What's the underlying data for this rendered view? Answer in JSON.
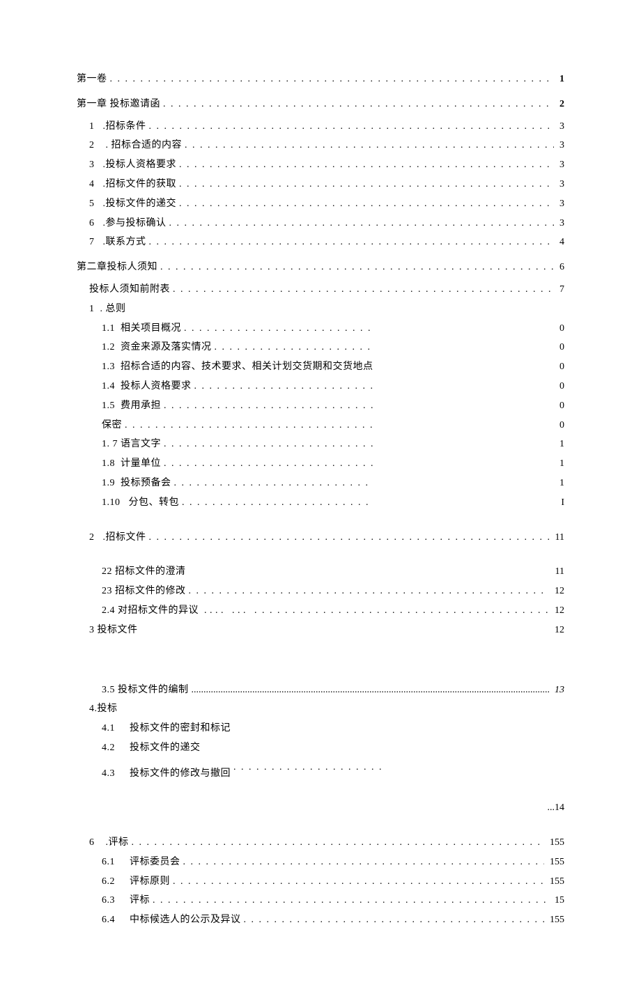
{
  "toc": {
    "vol1": {
      "label": "第一卷",
      "page": "1"
    },
    "ch1": {
      "label": "第一章   投标邀请函",
      "page": "2"
    },
    "ch1_items": [
      {
        "num": "1",
        "title": ".招标条件",
        "page": "3"
      },
      {
        "num": "2",
        "title": " . 招标合适的内容",
        "page": "3"
      },
      {
        "num": "3",
        "title": ".投标人资格要求",
        "page": "3"
      },
      {
        "num": "4",
        "title": ".招标文件的获取",
        "page": "3"
      },
      {
        "num": "5",
        "title": ".投标文件的递交",
        "page": "3"
      },
      {
        "num": "6",
        "title": ".参与投标确认",
        "page": "3"
      },
      {
        "num": "7",
        "title": ".联系方式",
        "page": "4"
      }
    ],
    "ch2": {
      "label": "第二章投标人须知",
      "page": "6"
    },
    "ch2_pre": {
      "label": "投标人须知前附表",
      "page": "7"
    },
    "s1": {
      "num": "1",
      "title": ". 总则",
      "page": ""
    },
    "s1_items_a": [
      {
        "num": "1.1",
        "title": "相关项目概况",
        "page": "0"
      },
      {
        "num": "1.2",
        "title": "资金来源及落实情况",
        "page": "0"
      },
      {
        "num": "1.3",
        "title": "招标合适的内容、技术要求、相关计划交货期和交货地点…",
        "page": "0"
      },
      {
        "num": "1.4",
        "title": "投标人资格要求",
        "page": "0"
      },
      {
        "num": "1.5",
        "title": "费用承担",
        "page": "0"
      },
      {
        "num": "",
        "title": "保密",
        "page": "0"
      },
      {
        "num": "",
        "title": "1. 7 语言文字",
        "page": "1"
      },
      {
        "num": "1.8",
        "title": "计量单位",
        "page": "1"
      },
      {
        "num": "1.9",
        "title": "投标预备会",
        "page": "1"
      },
      {
        "num": "1.10",
        "title": " 分包、转包",
        "page": "I"
      }
    ],
    "s2": {
      "num": "2",
      "title": ".招标文件",
      "page": "11"
    },
    "s2_items": [
      {
        "num": "",
        "title": "22 招标文件的澄清",
        "page": "11",
        "leader": "blank"
      },
      {
        "num": "",
        "title": "23 招标文件的修改",
        "page": "12",
        "leader": "dots"
      },
      {
        "num": "",
        "title": "2.4 对招标文件的异议",
        "page": "12",
        "leader": "dots",
        "extra_gap": true
      }
    ],
    "s3": {
      "label": "3 投标文件",
      "page": "12"
    },
    "s3_5": {
      "label": "3.5 投标文件的编制",
      "page": "13"
    },
    "s4": {
      "label": "4.投标",
      "page": ""
    },
    "s4_items": [
      {
        "num": "4.1",
        "title": "投标文件的密封和标记"
      },
      {
        "num": "4.2",
        "title": "投标文件的递交"
      },
      {
        "num": "4.3",
        "title": "投标文件的修改与撤回"
      }
    ],
    "tail14": "...14",
    "s6": {
      "num": "6",
      "title": ".评标",
      "page": "155"
    },
    "s6_items": [
      {
        "num": "6.1",
        "title": "评标委员会",
        "page": "155"
      },
      {
        "num": "6.2",
        "title": "评标原则",
        "page": "155"
      },
      {
        "num": "6.3",
        "title": "评标",
        "page": "15"
      },
      {
        "num": "6.4",
        "title": "中标候选人的公示及异议",
        "page": "155"
      }
    ]
  }
}
